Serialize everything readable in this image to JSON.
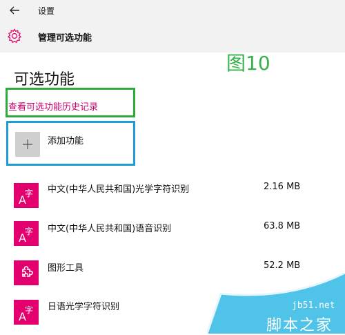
{
  "titlebar": {
    "title": "设置"
  },
  "header": {
    "title": "管理可选功能"
  },
  "figure_label": "图10",
  "section": {
    "title": "可选功能"
  },
  "history_link": "查看可选功能历史记录",
  "add_feature": {
    "label": "添加功能"
  },
  "features": [
    {
      "name": "中文(中华人民共和国)光学字符识别",
      "size": "2.16 MB",
      "icon": "language-icon"
    },
    {
      "name": "中文(中华人民共和国)语音识别",
      "size": "63.8 MB",
      "icon": "language-icon"
    },
    {
      "name": "图形工具",
      "size": "52.2 MB",
      "icon": "puzzle-icon"
    },
    {
      "name": "日语光学字符识别",
      "size": "",
      "icon": "language-icon"
    }
  ],
  "watermark": {
    "url": "jb51.net",
    "name": "脚本之家"
  },
  "colors": {
    "accent": "#e3006e",
    "link": "#c5006c",
    "green_outline": "#2eaa3a",
    "blue_outline": "#1f9bd8",
    "figure_label": "#34b34a",
    "titlebar_bg": "#f2f2f2"
  }
}
